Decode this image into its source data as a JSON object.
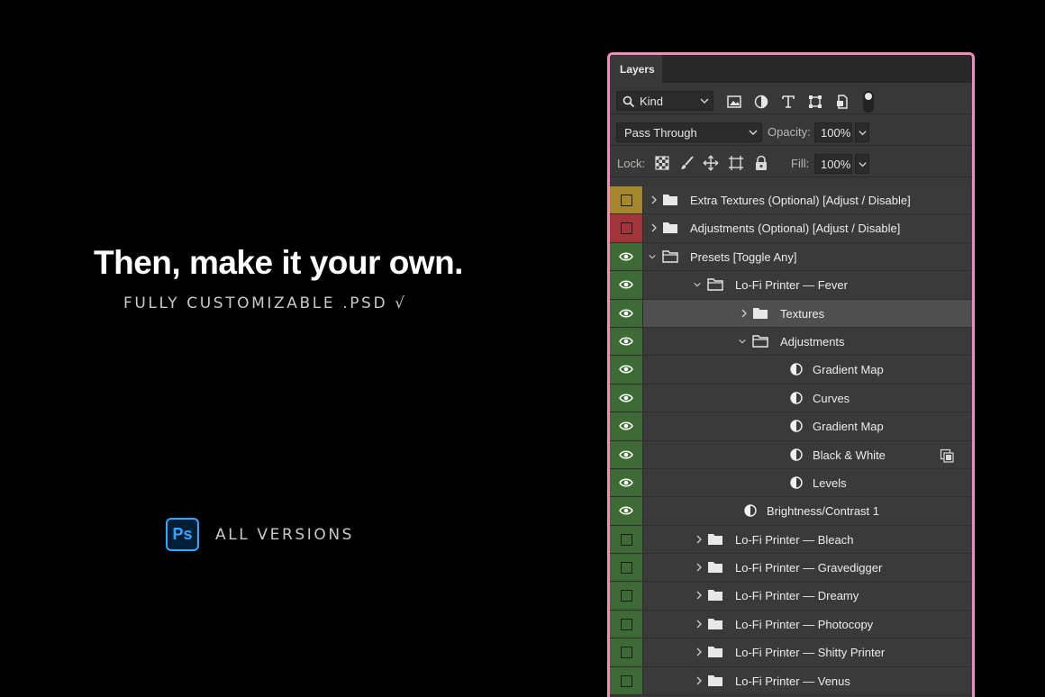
{
  "promo": {
    "headline": "Then, make it your own.",
    "subline": "FULLY CUSTOMIZABLE .PSD √",
    "badge_text": "Ps",
    "versions": "ALL VERSIONS"
  },
  "panel": {
    "tab": "Layers",
    "filter_kind": "Kind",
    "blend_mode": "Pass Through",
    "opacity_label": "Opacity:",
    "opacity_value": "100%",
    "lock_label": "Lock:",
    "fill_label": "Fill:",
    "fill_value": "100%"
  },
  "layers": [
    {
      "name": "Extra Textures (Optional) [Adjust / Disable]",
      "type": "folder",
      "depth": 0,
      "expanded": false,
      "visible": false,
      "color": "yellow"
    },
    {
      "name": "Adjustments (Optional) [Adjust / Disable]",
      "type": "folder",
      "depth": 0,
      "expanded": false,
      "visible": false,
      "color": "red"
    },
    {
      "name": "Presets [Toggle Any]",
      "type": "folder",
      "depth": 0,
      "expanded": true,
      "visible": true,
      "color": "green"
    },
    {
      "name": "Lo-Fi Printer — Fever",
      "type": "folder",
      "depth": 1,
      "expanded": true,
      "visible": true,
      "color": "green"
    },
    {
      "name": "Textures",
      "type": "folder",
      "depth": 2,
      "expanded": false,
      "visible": true,
      "color": "green",
      "selected": true
    },
    {
      "name": "Adjustments",
      "type": "folder",
      "depth": 2,
      "expanded": true,
      "visible": true,
      "color": "green"
    },
    {
      "name": "Gradient Map",
      "type": "adjustment",
      "depth": 3,
      "visible": true,
      "color": "green"
    },
    {
      "name": "Curves",
      "type": "adjustment",
      "depth": 3,
      "visible": true,
      "color": "green"
    },
    {
      "name": "Gradient Map",
      "type": "adjustment",
      "depth": 3,
      "visible": true,
      "color": "green"
    },
    {
      "name": "Black & White",
      "type": "adjustment",
      "depth": 3,
      "visible": true,
      "color": "green",
      "clipped": true
    },
    {
      "name": "Levels",
      "type": "adjustment",
      "depth": 3,
      "visible": true,
      "color": "green"
    },
    {
      "name": "Brightness/Contrast 1",
      "type": "adjustment",
      "depth": 2,
      "visible": true,
      "color": "green"
    },
    {
      "name": "Lo-Fi Printer — Bleach",
      "type": "folder",
      "depth": 1,
      "expanded": false,
      "visible": false,
      "color": "green"
    },
    {
      "name": "Lo-Fi Printer — Gravedigger",
      "type": "folder",
      "depth": 1,
      "expanded": false,
      "visible": false,
      "color": "green"
    },
    {
      "name": "Lo-Fi Printer — Dreamy",
      "type": "folder",
      "depth": 1,
      "expanded": false,
      "visible": false,
      "color": "green"
    },
    {
      "name": "Lo-Fi Printer — Photocopy",
      "type": "folder",
      "depth": 1,
      "expanded": false,
      "visible": false,
      "color": "green"
    },
    {
      "name": "Lo-Fi Printer — Shitty Printer",
      "type": "folder",
      "depth": 1,
      "expanded": false,
      "visible": false,
      "color": "green"
    },
    {
      "name": "Lo-Fi Printer — Venus",
      "type": "folder",
      "depth": 1,
      "expanded": false,
      "visible": false,
      "color": "green"
    }
  ]
}
